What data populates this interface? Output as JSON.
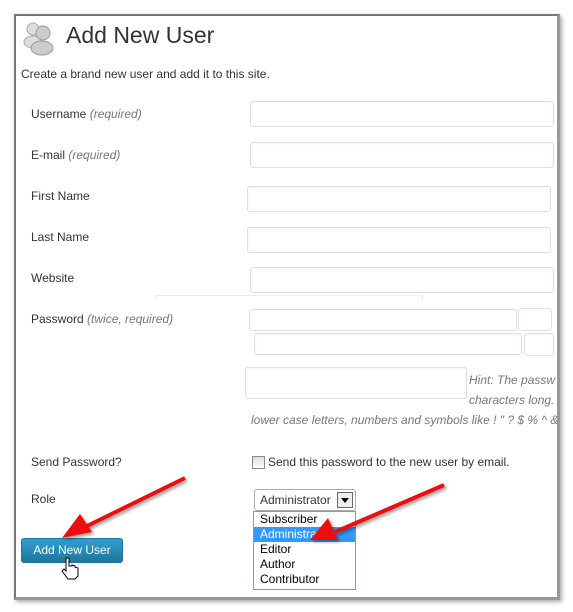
{
  "header": {
    "title": "Add New User",
    "icon": "users-icon",
    "description": "Create a brand new user and add it to this site."
  },
  "form": {
    "username": {
      "label": "Username",
      "note": "(required)",
      "value": ""
    },
    "email": {
      "label": "E-mail",
      "note": "(required)",
      "value": ""
    },
    "first_name": {
      "label": "First Name",
      "value": ""
    },
    "last_name": {
      "label": "Last Name",
      "value": ""
    },
    "website": {
      "label": "Website",
      "value": ""
    },
    "password": {
      "label": "Password",
      "note": "(twice, required)",
      "value1": "",
      "value2": ""
    },
    "hint": {
      "line1": "Hint: The passw",
      "line2": "characters long.",
      "line3": "lower case letters, numbers and symbols like ! \" ? $ % ^ &"
    },
    "send_password": {
      "label": "Send Password?",
      "checkbox_label": "Send this password to the new user by email.",
      "checked": false
    },
    "role": {
      "label": "Role",
      "selected": "Administrator",
      "options": [
        "Subscriber",
        "Administrator",
        "Editor",
        "Author",
        "Contributor"
      ],
      "highlighted": "Administrator"
    },
    "submit_label": "Add New User"
  },
  "colors": {
    "button": "#21759b",
    "highlight": "#3399ff",
    "arrow": "#ee1111"
  }
}
